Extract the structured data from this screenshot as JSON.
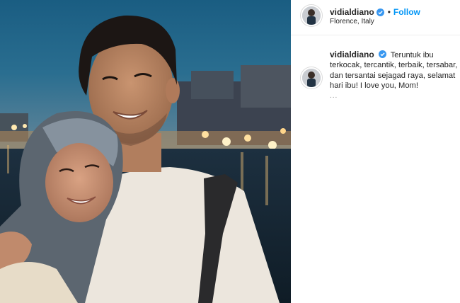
{
  "post": {
    "image_alt": "Photo of a young man and a woman in a hijab smiling by the river at dusk"
  },
  "header": {
    "username": "vidialdiano",
    "dot": "•",
    "follow_label": "Follow",
    "location": "Florence, Italy"
  },
  "caption": {
    "username": "vidialdiano",
    "text": "Teruntuk ibu terkocak, tercantik, terbaik, tersabar, dan tersantai sejagad raya, selamat hari ibu! I love you, Mom!",
    "more_indicator": "..."
  },
  "colors": {
    "follow_blue": "#0095f6",
    "verified_blue": "#3897f0",
    "text_dark": "#262626",
    "divider": "#efefef"
  },
  "icons": {
    "verified": "verified-badge-icon"
  }
}
